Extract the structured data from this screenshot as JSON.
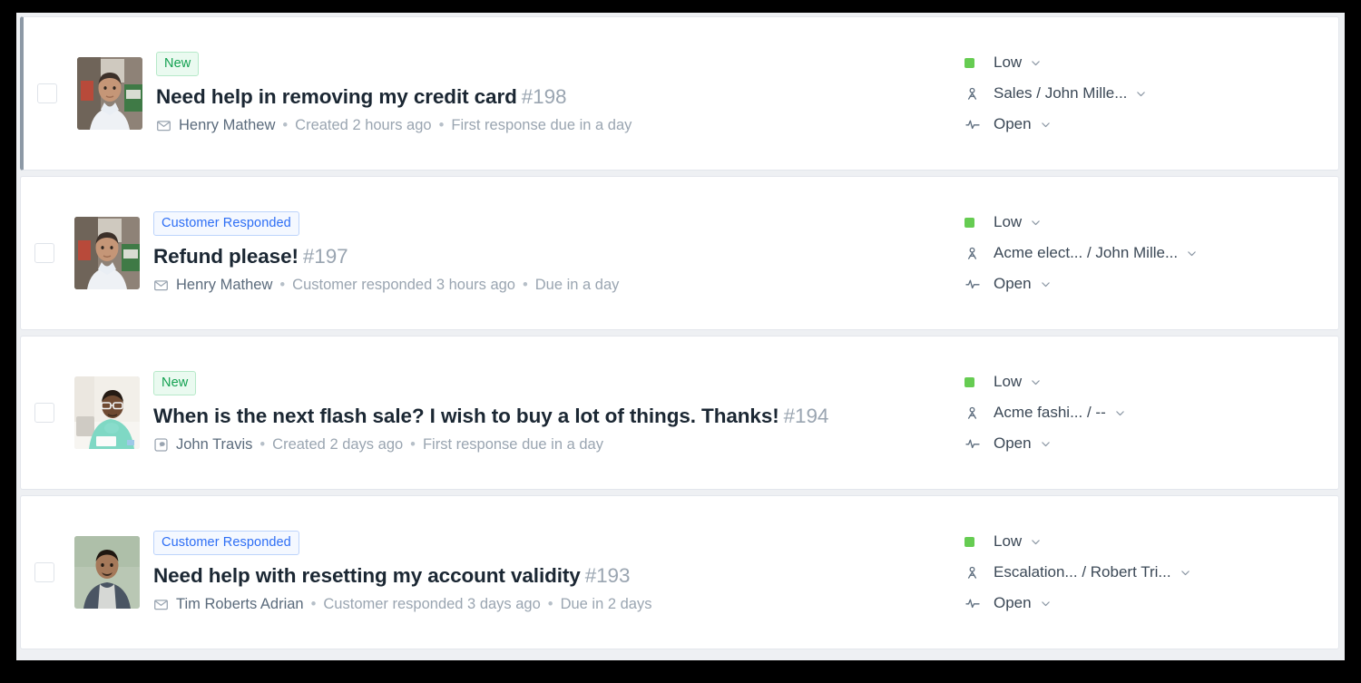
{
  "colors": {
    "priority_low_dot": "#66cc52",
    "badge_new_text": "#12a150",
    "badge_responded_text": "#2d6ef5",
    "selected_indicator": "#8d99a6",
    "ticket_id": "#9aa5b1"
  },
  "icons": {
    "email": "envelope-icon",
    "portal": "portal-icon",
    "agent": "person-icon",
    "status": "activity-icon",
    "caret": "chevron-down-icon",
    "checkbox": "checkbox-icon"
  },
  "tickets": [
    {
      "selected": true,
      "checkbox_checked": false,
      "avatar": "avatar-henry-mathew",
      "badge": {
        "label": "New",
        "style": "new"
      },
      "subject": "Need help in removing my credit card",
      "ticket_id": "#198",
      "channel_icon": "envelope-icon",
      "requester": "Henry Mathew",
      "meta": [
        "Created 2 hours ago",
        "First response due in a day"
      ],
      "priority": "Low",
      "assignee": "Sales / John Mille...",
      "status": "Open"
    },
    {
      "selected": false,
      "checkbox_checked": false,
      "avatar": "avatar-henry-mathew",
      "badge": {
        "label": "Customer Responded",
        "style": "responded"
      },
      "subject": "Refund please!",
      "ticket_id": "#197",
      "channel_icon": "envelope-icon",
      "requester": "Henry Mathew",
      "meta": [
        "Customer responded 3 hours ago",
        "Due in a day"
      ],
      "priority": "Low",
      "assignee": "Acme elect... / John Mille...",
      "status": "Open"
    },
    {
      "selected": false,
      "checkbox_checked": false,
      "avatar": "avatar-john-travis",
      "badge": {
        "label": "New",
        "style": "new"
      },
      "subject": "When is the next flash sale? I wish to buy a lot of things. Thanks!",
      "ticket_id": "#194",
      "channel_icon": "portal-icon",
      "requester": "John Travis",
      "meta": [
        "Created 2 days ago",
        "First response due in a day"
      ],
      "priority": "Low",
      "assignee": "Acme fashi... / --",
      "status": "Open"
    },
    {
      "selected": false,
      "checkbox_checked": false,
      "avatar": "avatar-tim-roberts-adrian",
      "badge": {
        "label": "Customer Responded",
        "style": "responded"
      },
      "subject": "Need help with resetting my account validity",
      "ticket_id": "#193",
      "channel_icon": "envelope-icon",
      "requester": "Tim Roberts Adrian",
      "meta": [
        "Customer responded 3 days ago",
        "Due in 2 days"
      ],
      "priority": "Low",
      "assignee": "Escalation... / Robert Tri...",
      "status": "Open"
    }
  ]
}
